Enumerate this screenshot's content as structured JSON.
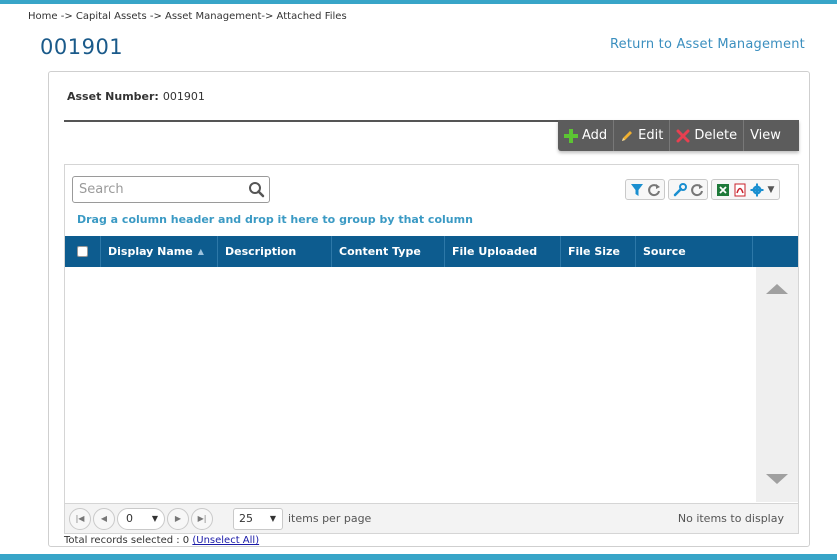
{
  "breadcrumb": "Home -> Capital Assets -> Asset Management-> Attached Files",
  "page_title": "001901",
  "return_link": "Return to Asset Management",
  "asset": {
    "label": "Asset Number:",
    "value": "001901"
  },
  "actions": {
    "add": "Add",
    "edit": "Edit",
    "delete": "Delete",
    "view": "View"
  },
  "search": {
    "placeholder": "Search",
    "value": ""
  },
  "toolbar_icons": [
    "filter-icon",
    "refresh-icon",
    "wrench-icon",
    "refresh-icon",
    "excel-icon",
    "pdf-icon",
    "gear-icon"
  ],
  "group_hint": "Drag a column header and drop it here to group by that column",
  "columns": [
    "Display Name",
    "Description",
    "Content Type",
    "File Uploaded",
    "File Size",
    "Source"
  ],
  "pager": {
    "page": "0",
    "page_size": "25",
    "page_size_label": "items per page",
    "status": "No items to display"
  },
  "footer": {
    "total_label": "Total records selected : 0",
    "unselect": "(Unselect All)"
  },
  "colors": {
    "accent": "#38a5c8",
    "header": "#0d5c8f",
    "title": "#1a5a8a",
    "action_bar": "#5c5c5c"
  }
}
